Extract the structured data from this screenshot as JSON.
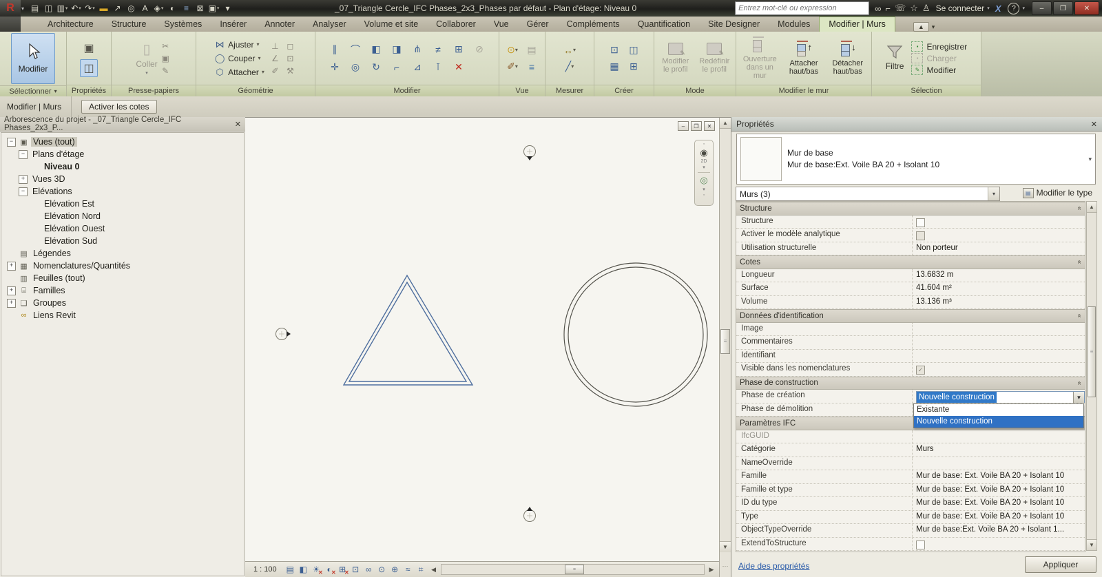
{
  "glyphs": {
    "dd": "▾",
    "close": "✕",
    "up": "▲",
    "down": "▼",
    "left": "◀",
    "right": "▶",
    "minimize": "‒",
    "restore": "❐",
    "chevron": "«",
    "check": "✓",
    "grip": "≡",
    "grip_dots": "⋯",
    "help": "?"
  },
  "titlebar": {
    "title": "_07_Triangle Cercle_IFC Phases_2x3_Phases par défaut - Plan d'étage: Niveau 0",
    "app_logo": "R",
    "search": {
      "placeholder": "Entrez mot-clé ou expression"
    },
    "signin": "Se connecter",
    "exchange": "X",
    "qat": [
      {
        "name": "open-icon",
        "glyph": "▤"
      },
      {
        "name": "save-icon",
        "glyph": "◫"
      },
      {
        "name": "print-icon",
        "glyph": "▥",
        "dd": true
      },
      {
        "name": "undo-icon",
        "glyph": "↶",
        "dd": true
      },
      {
        "name": "redo-icon",
        "glyph": "↷",
        "dd": true
      },
      {
        "name": "measure-icon",
        "glyph": "▬",
        "color": "#d7a728"
      },
      {
        "name": "aligned-dimension-icon",
        "glyph": "↗"
      },
      {
        "name": "tag-by-category-icon",
        "glyph": "◎"
      },
      {
        "name": "text-icon",
        "glyph": "A"
      },
      {
        "name": "default-3d-view-icon",
        "glyph": "◈",
        "dd": true
      },
      {
        "name": "section-icon",
        "glyph": "◐"
      },
      {
        "name": "thin-lines-icon",
        "glyph": "≡",
        "color": "#8fb0d8"
      },
      {
        "name": "close-hidden-windows-icon",
        "glyph": "⊠"
      },
      {
        "name": "switch-windows-icon",
        "glyph": "▣",
        "dd": true
      },
      {
        "name": "customize-qat-icon",
        "glyph": "▾"
      }
    ],
    "infocenter": [
      {
        "name": "search-binoculars-icon",
        "glyph": "∞"
      },
      {
        "name": "subscription-center-icon",
        "glyph": "⌐"
      },
      {
        "name": "communication-center-icon",
        "glyph": "☏"
      },
      {
        "name": "favorites-star-icon",
        "glyph": "☆"
      },
      {
        "name": "signin-person-icon",
        "glyph": "♙"
      }
    ]
  },
  "tabs": [
    {
      "label": "Architecture"
    },
    {
      "label": "Structure"
    },
    {
      "label": "Systèmes"
    },
    {
      "label": "Insérer"
    },
    {
      "label": "Annoter"
    },
    {
      "label": "Analyser"
    },
    {
      "label": "Volume et site"
    },
    {
      "label": "Collaborer"
    },
    {
      "label": "Vue"
    },
    {
      "label": "Gérer"
    },
    {
      "label": "Compléments"
    },
    {
      "label": "Quantification"
    },
    {
      "label": "Site Designer"
    },
    {
      "label": "Modules"
    },
    {
      "label": "Modifier | Murs",
      "active": true
    }
  ],
  "ribbon": {
    "select_panel": {
      "button": "Modifier",
      "label": "Sélectionner"
    },
    "properties_panel": {
      "label": "Propriétés"
    },
    "clipboard_panel": {
      "paste": "Coller",
      "label": "Presse-papiers",
      "icons": [
        {
          "name": "cut-icon",
          "glyph": "✂"
        },
        {
          "name": "copy-icon",
          "glyph": "▣"
        },
        {
          "name": "match-type-icon",
          "glyph": "✎"
        }
      ]
    },
    "geometry_panel": {
      "label": "Géométrie",
      "items": [
        {
          "label": "Ajuster",
          "icon_name": "join-icon",
          "glyph": "⋈",
          "color": "#46628a"
        },
        {
          "label": "Couper",
          "icon_name": "cut-geometry-icon",
          "glyph": "◯",
          "color": "#46628a"
        },
        {
          "label": "Attacher",
          "icon_name": "attach-icon",
          "glyph": "⬡",
          "color": "#46628a"
        }
      ],
      "right_icons": [
        {
          "name": "wall-joins-icon",
          "glyph": "⊥"
        },
        {
          "name": "beam-join-icon",
          "glyph": "◻"
        },
        {
          "name": "cut-profile-icon",
          "glyph": "∠"
        },
        {
          "name": "unjoin-icon",
          "glyph": "⊡"
        },
        {
          "name": "linework-icon",
          "glyph": "✐"
        },
        {
          "name": "demolish-hammer-icon",
          "glyph": "⚒"
        }
      ]
    },
    "modify_panel": {
      "label": "Modifier",
      "icons": [
        {
          "name": "align-icon",
          "glyph": "∥"
        },
        {
          "name": "offset-icon",
          "glyph": "⌒"
        },
        {
          "name": "mirror-pick-axis-icon",
          "glyph": "◧"
        },
        {
          "name": "mirror-draw-axis-icon",
          "glyph": "◨"
        },
        {
          "name": "split-element-icon",
          "glyph": "⋔"
        },
        {
          "name": "split-with-gap-icon",
          "glyph": "≠"
        },
        {
          "name": "array-icon",
          "glyph": "⊞"
        },
        {
          "name": "unpin-icon",
          "glyph": "⊘",
          "disabled": true
        },
        {
          "name": "move-icon",
          "glyph": "✛"
        },
        {
          "name": "copy-icon",
          "glyph": "◎"
        },
        {
          "name": "rotate-icon",
          "glyph": "↻"
        },
        {
          "name": "trim-extend-icon",
          "glyph": "⌐"
        },
        {
          "name": "scale-icon",
          "glyph": "⊿"
        },
        {
          "name": "pin-icon",
          "glyph": "⊺"
        },
        {
          "name": "delete-icon",
          "glyph": "✕",
          "color": "#c0271b"
        }
      ]
    },
    "view_panel": {
      "label": "Vue",
      "icons": [
        {
          "name": "hide-elements-bulb-icon",
          "glyph": "⊙",
          "color": "#c89a1e",
          "dd": true
        },
        {
          "name": "override-graphics-icon",
          "glyph": "▤",
          "disabled": true
        },
        {
          "name": "linework-brush-icon",
          "glyph": "✐",
          "color": "#8a5a2a",
          "dd": true
        },
        {
          "name": "cut-plane-icon",
          "glyph": "≡",
          "color": "#3a6ea5"
        }
      ]
    },
    "measure_panel": {
      "label": "Mesurer",
      "icons": [
        {
          "name": "measure-tape-icon",
          "glyph": "↔",
          "color": "#8a6a10",
          "dd": true
        },
        {
          "name": "aligned-dimension-icon",
          "glyph": "╱",
          "dd": true
        }
      ]
    },
    "create_panel": {
      "label": "Créer",
      "icons": [
        {
          "name": "legend-component-icon",
          "glyph": "⊡"
        },
        {
          "name": "create-similar-icon",
          "glyph": "◫"
        },
        {
          "name": "create-group-icon",
          "glyph": "▦"
        },
        {
          "name": "create-assembly-icon",
          "glyph": "⊞"
        }
      ]
    },
    "mode_panel": {
      "label": "Mode",
      "buttons": [
        {
          "label": "Modifier\nle profil"
        },
        {
          "label": "Redéfinir\nle profil"
        }
      ]
    },
    "wall_panel": {
      "label": "Modifier le mur",
      "buttons": [
        {
          "label": "Ouverture\ndans un mur",
          "kind": "opening",
          "disabled": true
        },
        {
          "label": "Attacher\nhaut/bas",
          "kind": "attach",
          "arrow": "↑"
        },
        {
          "label": "Détacher\nhaut/bas",
          "kind": "detach",
          "arrow": "↓"
        }
      ]
    },
    "selection_panel": {
      "label": "Sélection",
      "filter": "Filtre",
      "items": [
        {
          "label": "Enregistrer",
          "icon": "save-selection-icon",
          "glyph": "▪"
        },
        {
          "label": "Charger",
          "icon": "load-selection-icon",
          "glyph": "▪",
          "disabled": true
        },
        {
          "label": "Modifier",
          "icon": "edit-selection-icon",
          "glyph": "✎"
        }
      ]
    }
  },
  "modebar": {
    "context": "Modifier | Murs",
    "button": "Activer les cotes"
  },
  "browser": {
    "title": "Arborescence du projet - _07_Triangle Cercle_IFC Phases_2x3_P...",
    "items": [
      {
        "label": "Vues (tout)",
        "indent": 0,
        "expander": "-",
        "icon": "views-icon",
        "glyph": "▣",
        "selected": true
      },
      {
        "label": "Plans d'étage",
        "indent": 1,
        "expander": "-"
      },
      {
        "label": "Niveau 0",
        "indent": 2,
        "bold": true
      },
      {
        "label": "Vues 3D",
        "indent": 1,
        "expander": "+"
      },
      {
        "label": "Elévations",
        "indent": 1,
        "expander": "-"
      },
      {
        "label": "Elévation Est",
        "indent": 2
      },
      {
        "label": "Elévation Nord",
        "indent": 2
      },
      {
        "label": "Elévation Ouest",
        "indent": 2
      },
      {
        "label": "Elévation Sud",
        "indent": 2
      },
      {
        "label": "Légendes",
        "indent": 0,
        "icon": "legend-icon",
        "glyph": "▤"
      },
      {
        "label": "Nomenclatures/Quantités",
        "indent": 0,
        "expander": "+",
        "icon": "schedule-icon",
        "glyph": "▦"
      },
      {
        "label": "Feuilles (tout)",
        "indent": 0,
        "icon": "sheet-icon",
        "glyph": "▥"
      },
      {
        "label": "Familles",
        "indent": 0,
        "expander": "+",
        "icon": "family-icon",
        "glyph": "⌸"
      },
      {
        "label": "Groupes",
        "indent": 0,
        "expander": "+",
        "icon": "group-icon",
        "glyph": "❑"
      },
      {
        "label": "Liens Revit",
        "indent": 0,
        "icon": "revit-link-icon",
        "glyph": "∞",
        "color": "#b08a20"
      }
    ]
  },
  "canvas": {
    "scale": "1 : 100",
    "nav": {
      "wheel_label": "2D"
    },
    "viewbar_icons": [
      {
        "name": "detail-level-icon",
        "glyph": "▤"
      },
      {
        "name": "visual-style-icon",
        "glyph": "◧"
      },
      {
        "name": "sun-path-icon",
        "glyph": "☀",
        "off": true
      },
      {
        "name": "shadows-icon",
        "glyph": "◐",
        "off": true
      },
      {
        "name": "crop-view-icon",
        "glyph": "⊞",
        "off": true
      },
      {
        "name": "crop-region-visible-icon",
        "glyph": "⊡"
      },
      {
        "name": "temporary-hide-isolate-icon",
        "glyph": "∞"
      },
      {
        "name": "reveal-hidden-elements-icon",
        "glyph": "⊙"
      },
      {
        "name": "worksharing-display-icon",
        "glyph": "⊕"
      },
      {
        "name": "analytical-model-icon",
        "glyph": "≈"
      },
      {
        "name": "reveal-constraints-icon",
        "glyph": "⌗"
      }
    ]
  },
  "properties": {
    "header": "Propriétés",
    "type_family": "Mur de base",
    "type_name": "Mur de base:Ext. Voile BA 20 + Isolant 10",
    "selection_combo": "Murs (3)",
    "edit_type": "Modifier le type",
    "rows": [
      {
        "kind": "section",
        "label": "Structure"
      },
      {
        "kind": "row",
        "label": "Structure",
        "value": "",
        "checkbox": "unchecked"
      },
      {
        "kind": "row",
        "label": "Activer le modèle analytique",
        "checkbox": "unchecked-disabled"
      },
      {
        "kind": "row",
        "label": "Utilisation structurelle",
        "value": "Non porteur"
      },
      {
        "kind": "section",
        "label": "Cotes"
      },
      {
        "kind": "row",
        "label": "Longueur",
        "value": "13.6832 m"
      },
      {
        "kind": "row",
        "label": "Surface",
        "value": "41.604 m²"
      },
      {
        "kind": "row",
        "label": "Volume",
        "value": "13.136 m³"
      },
      {
        "kind": "section",
        "label": "Données d'identification"
      },
      {
        "kind": "row",
        "label": "Image",
        "value": ""
      },
      {
        "kind": "row",
        "label": "Commentaires",
        "value": ""
      },
      {
        "kind": "row",
        "label": "Identifiant",
        "value": ""
      },
      {
        "kind": "row",
        "label": "Visible dans les nomenclatures",
        "checkbox": "checked-disabled"
      },
      {
        "kind": "section",
        "label": "Phase de construction"
      },
      {
        "kind": "combo-open",
        "label": "Phase de création",
        "value": "Nouvelle construction"
      },
      {
        "kind": "row",
        "label": "Phase de démolition",
        "value": ""
      },
      {
        "kind": "section",
        "label": "Paramètres IFC"
      },
      {
        "kind": "row",
        "label": "IfcGUID",
        "value": "",
        "disabled": true
      },
      {
        "kind": "row",
        "label": "Catégorie",
        "value": "Murs"
      },
      {
        "kind": "row",
        "label": "NameOverride",
        "value": ""
      },
      {
        "kind": "row",
        "label": "Famille",
        "value": "Mur de base: Ext. Voile BA 20 + Isolant 10"
      },
      {
        "kind": "row",
        "label": "Famille et type",
        "value": "Mur de base: Ext. Voile BA 20 + Isolant 10"
      },
      {
        "kind": "row",
        "label": "ID du type",
        "value": "Mur de base: Ext. Voile BA 20 + Isolant 10"
      },
      {
        "kind": "row",
        "label": "Type",
        "value": "Mur de base: Ext. Voile BA 20 + Isolant 10"
      },
      {
        "kind": "row",
        "label": "ObjectTypeOverride",
        "value": "Mur de base:Ext. Voile BA 20 + Isolant 1..."
      },
      {
        "kind": "row",
        "label": "ExtendToStructure",
        "checkbox": "unchecked"
      }
    ],
    "dropdown_items": [
      {
        "label": "Existante"
      },
      {
        "label": "Nouvelle construction",
        "selected": true
      }
    ],
    "help_link": "Aide des propriétés",
    "apply_button": "Appliquer"
  },
  "colors": {
    "selection_blue": "#3179c8",
    "wall_selected": "#4f6f9f",
    "wall_line": "#54534c",
    "ribbon_green": "#a5c06c",
    "close_red": "#8f2c20"
  }
}
